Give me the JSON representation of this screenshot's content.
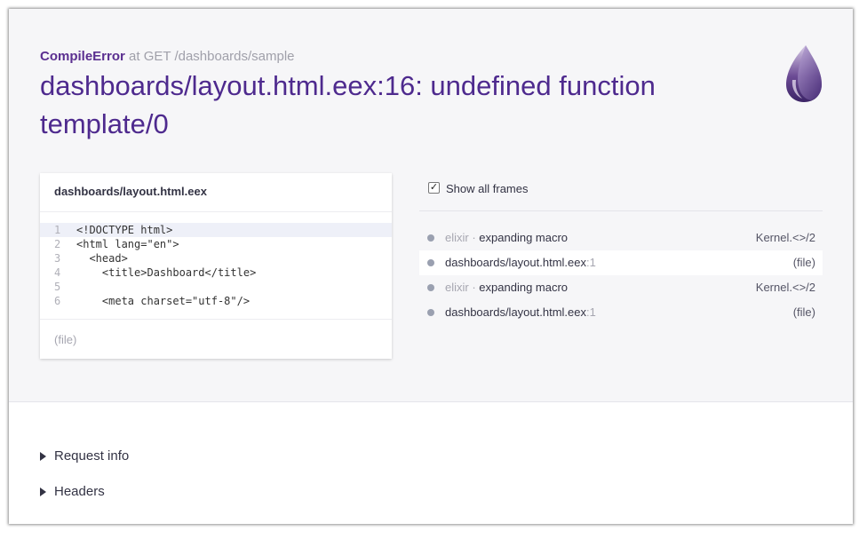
{
  "error": {
    "exception": "CompileError",
    "context": "at GET /dashboards/sample",
    "message": "dashboards/layout.html.eex:16: undefined function template/0"
  },
  "code": {
    "file": "dashboards/layout.html.eex",
    "lines": [
      {
        "num": "1",
        "text": "<!DOCTYPE html>",
        "highlighted": true
      },
      {
        "num": "2",
        "text": "<html lang=\"en\">"
      },
      {
        "num": "3",
        "text": "  <head>"
      },
      {
        "num": "4",
        "text": "    <title>Dashboard</title>"
      },
      {
        "num": "5",
        "text": ""
      },
      {
        "num": "6",
        "text": "    <meta charset=\"utf-8\"/>"
      }
    ],
    "footer": "(file)"
  },
  "frames_panel": {
    "show_all_label": "Show all frames",
    "show_all_checked": true,
    "frames": [
      {
        "app": "elixir",
        "sep": " · ",
        "info": "expanding macro",
        "line": "",
        "location": "Kernel.<>/2",
        "active": false
      },
      {
        "app": "",
        "sep": "",
        "info": "dashboards/layout.html.eex",
        "line": ":1",
        "location": "(file)",
        "active": true
      },
      {
        "app": "elixir",
        "sep": " · ",
        "info": "expanding macro",
        "line": "",
        "location": "Kernel.<>/2",
        "active": false
      },
      {
        "app": "",
        "sep": "",
        "info": "dashboards/layout.html.eex",
        "line": ":1",
        "location": "(file)",
        "active": false
      }
    ]
  },
  "sections": {
    "request_info": "Request info",
    "headers": "Headers"
  },
  "icons": {
    "logo": "elixir-drop-logo",
    "checkbox": "checkmark-icon",
    "expand": "triangle-right-icon"
  },
  "colors": {
    "accent": "#4e2a8e",
    "background": "#f6f6f8"
  }
}
